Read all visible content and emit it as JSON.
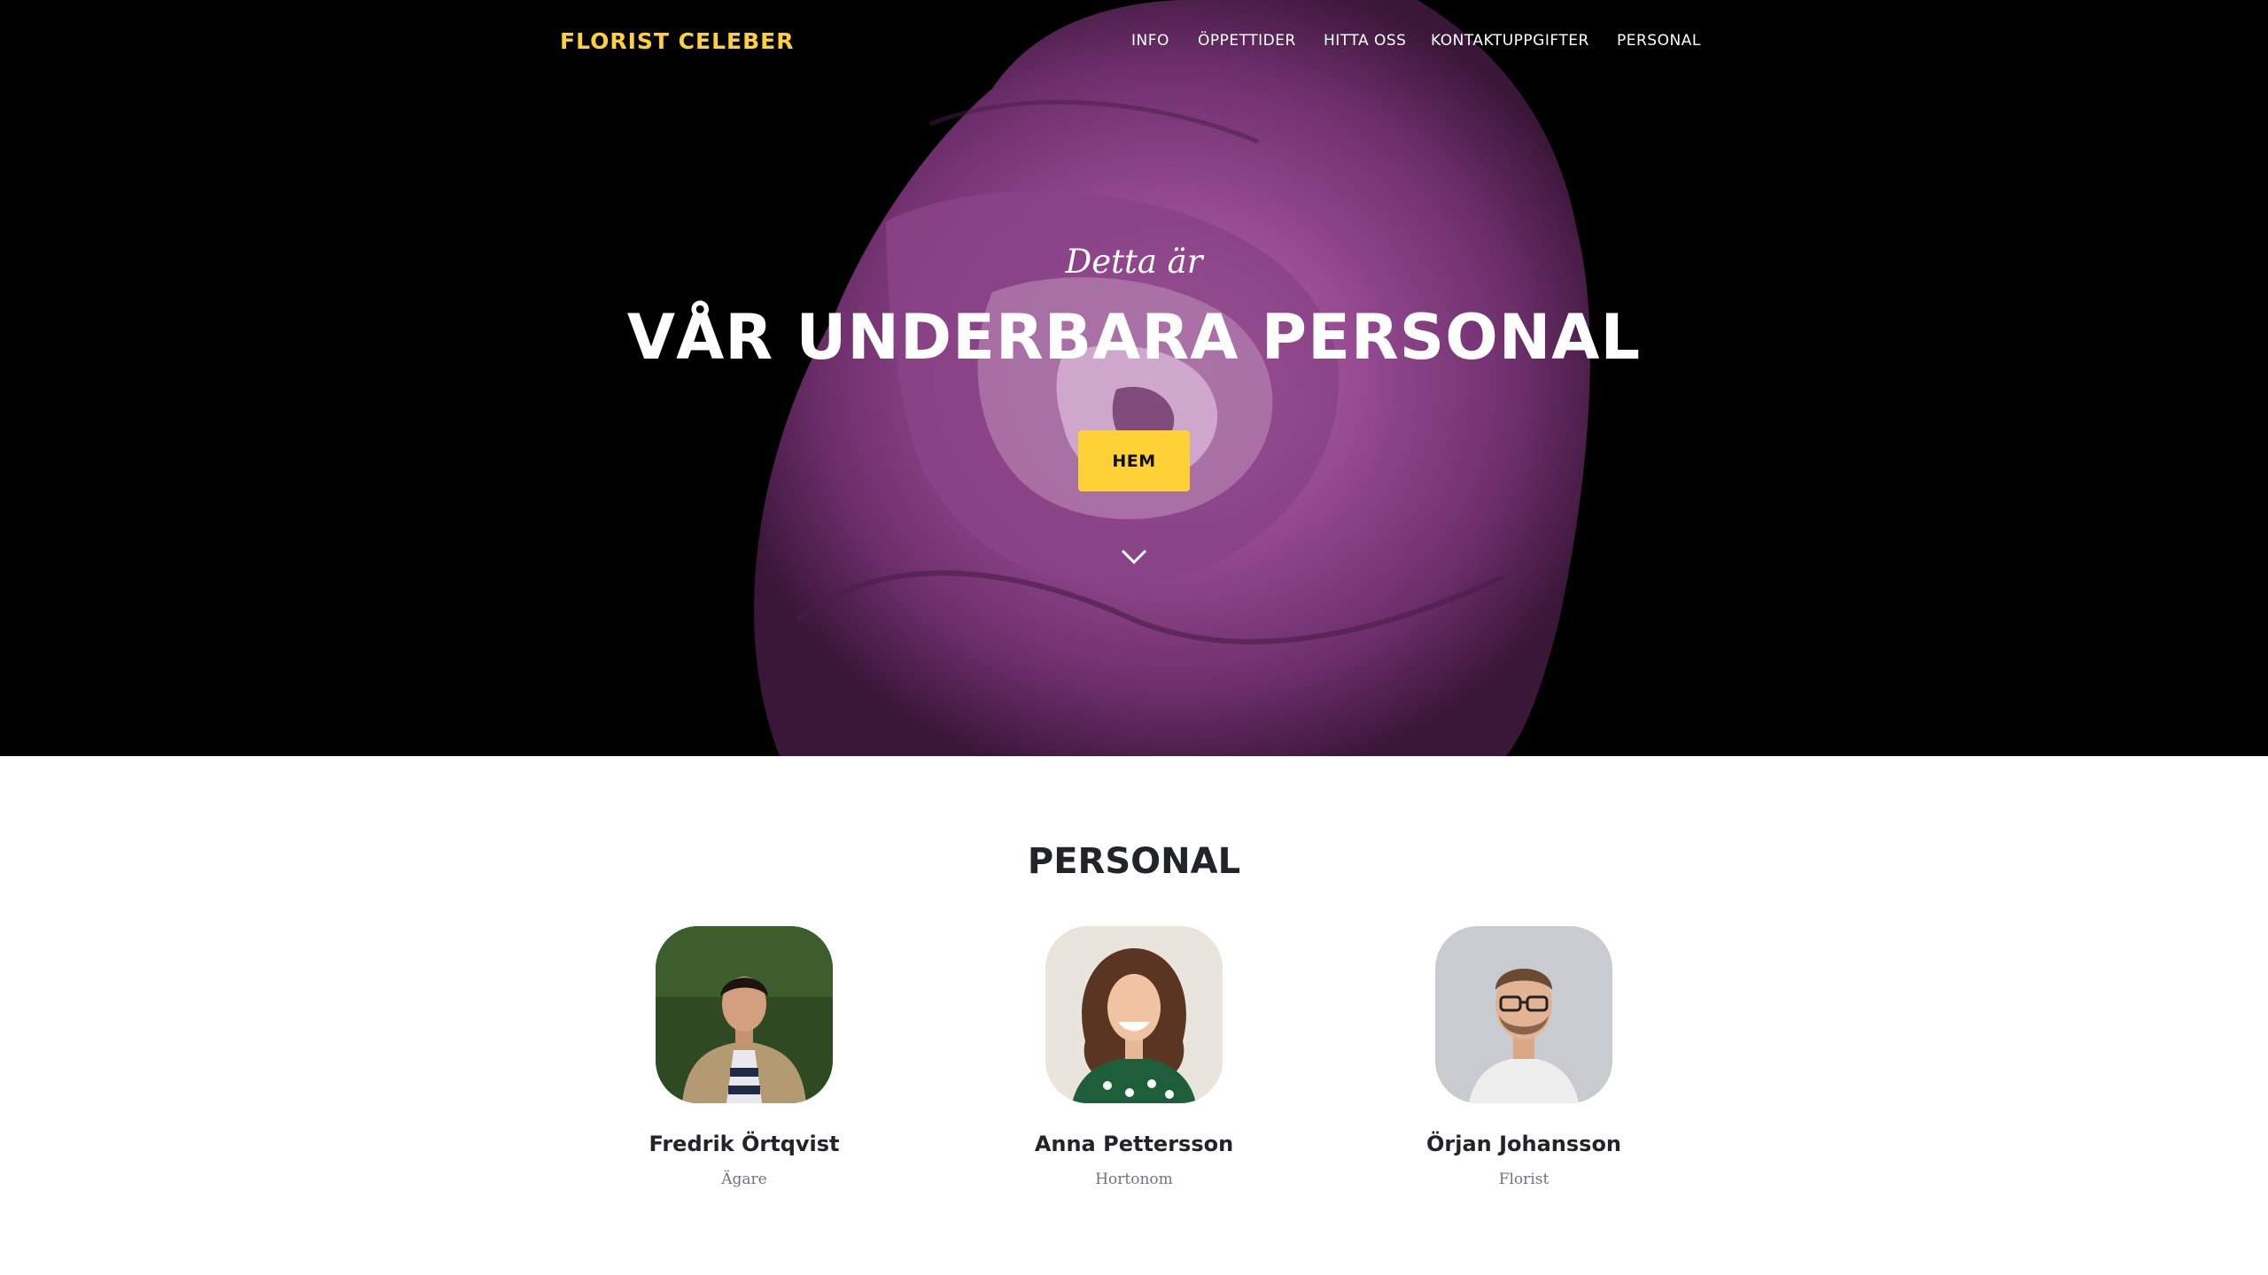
{
  "nav": {
    "brand": "FLORIST CELEBER",
    "items": [
      {
        "label": "INFO"
      },
      {
        "label": "ÖPPETTIDER"
      },
      {
        "label": "HITTA OSS"
      },
      {
        "label": "KONTAKTUPPGIFTER"
      },
      {
        "label": "PERSONAL"
      }
    ]
  },
  "hero": {
    "subheading": "Detta är",
    "heading": "VÅR UNDERBARA PERSONAL",
    "button_label": "HEM",
    "chevron_icon": "chevron-down-icon"
  },
  "team": {
    "title": "PERSONAL",
    "members": [
      {
        "name": "Fredrik Örtqvist",
        "role": "Ägare"
      },
      {
        "name": "Anna Pettersson",
        "role": "Hortonom"
      },
      {
        "name": "Örjan Johansson",
        "role": "Florist"
      }
    ]
  },
  "colors": {
    "accent": "#fed136",
    "hero_background": "#000000",
    "rose": "#7a3a7a",
    "text_dark": "#212529",
    "text_muted": "#6c757d"
  }
}
